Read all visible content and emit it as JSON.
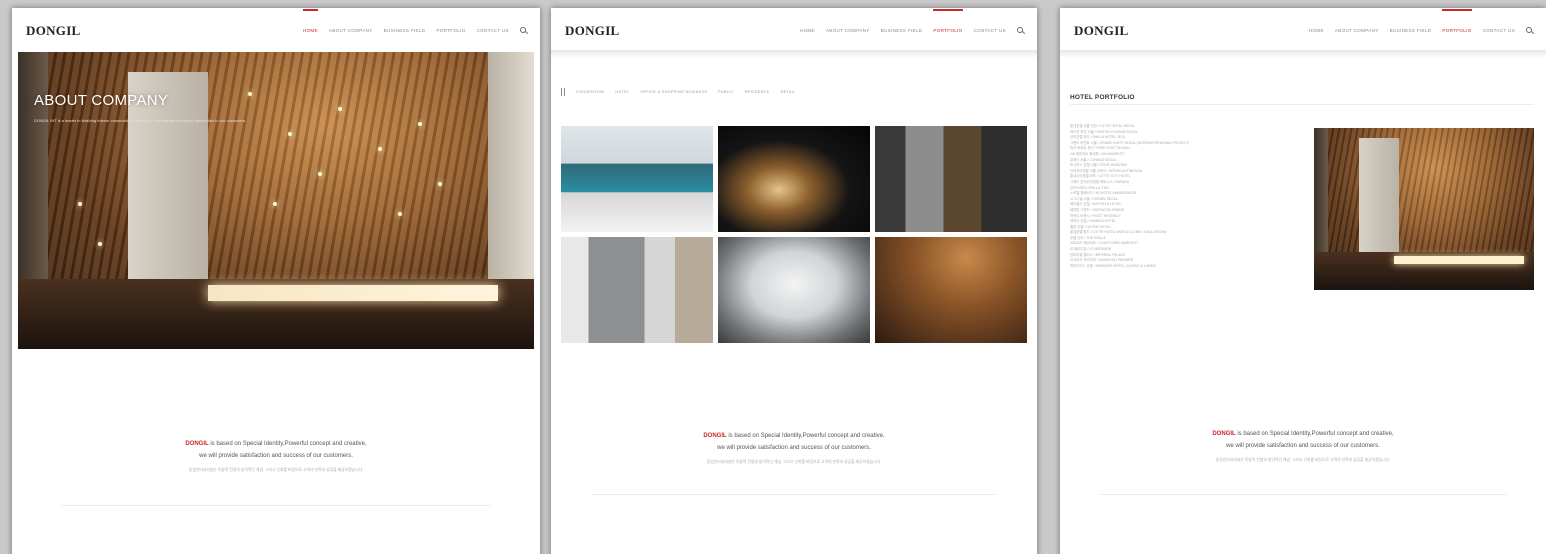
{
  "brand": "DONGIL",
  "nav_items": [
    "HOME",
    "ABOUT COMPANY",
    "BUSINESS FIELD",
    "PORTFOLIO",
    "CONTACT US"
  ],
  "accent_color": "#c7282e",
  "panel1": {
    "active_nav": "HOME",
    "hero_title": "ABOUT COMPANY",
    "hero_text": "DONGIL INT is a leader in finishing interior construction, ceiling and wall panels, providing satisfaction to our customers."
  },
  "panel2": {
    "active_nav": "PORTFOLIO",
    "filters": [
      "CONVENTION",
      "HOTEL",
      "OFFICE & SHOPPING BUSINESS",
      "PUBLIC",
      "RESIDENCE",
      "RETAIL"
    ]
  },
  "panel3": {
    "active_nav": "PORTFOLIO",
    "section_title": "HOTEL PORTFOLIO",
    "hotel_lines": [
      "롯데호텔 서울 신관 / LOTTE HOTEL SEOUL",
      "웨스틴 조선 서울 / WESTIN CHOSUN SEOUL",
      "신라호텔 제주 / SHILLA HOTEL JEJU",
      "그랜드 하얏트 서울 / GRAND HYATT SEOUL (INTERIOR RENEWAL PROJECT)",
      "파크 하얏트 부산 / PARK HYATT BUSAN",
      "JW 메리어트 동대문 / JW MARRIOTT",
      "콘래드 서울 / CONRAD SEOUL",
      "포시즌스 호텔 서울 / FOUR SEASONS",
      "인터컨티넨탈 서울 코엑스 / INTERCONTINENTAL",
      "롯데시티호텔 마포 / LOTTE CITY HOTEL",
      "그랜드 인터컨티넨탈 파르나스 / PARNAS",
      "신라스테이 / SHILLA STAY",
      "노보텔 앰배서더 / NOVOTEL AMBASSADOR",
      "시그니엘 서울 / SIGNIEL SEOUL",
      "메이필드 호텔 / MAYFIELD HOTEL",
      "쉐라톤 그랜드 / SHERATON GRAND",
      "하얏트 리젠시 / HYATT REGENCY",
      "라마다 호텔 / RAMADA HOTEL",
      "힐튼 호텔 / HILTON HOTEL",
      "롯데호텔 월드 / LOTTE HOTEL WORLD (LOBBY & BALLROOM)",
      "호텔 신라 / THE SHILLA",
      "코트야드 메리어트 / COURTYARD MARRIOTT",
      "르 메르디앙 / LE MERIDIEN",
      "임피리얼 팰리스 / IMPERIAL PALACE",
      "오크우드 프리미어 / OAKWOOD PREMIER",
      "파라다이스 호텔 / PARADISE HOTEL (CASINO & LOBBY)"
    ]
  },
  "tagline": {
    "brand": "DONGIL",
    "line1_rest": " is based on Special Identity,Powerful concept and creative,",
    "line2": "we will provide satisfaction and success of our customers.",
    "line3": "동일인터내셔널은 독창적 컨셉과 창의적인 개념, 그리고 신뢰를 바탕으로 고객의 만족과 성공을 제공하겠습니다."
  }
}
